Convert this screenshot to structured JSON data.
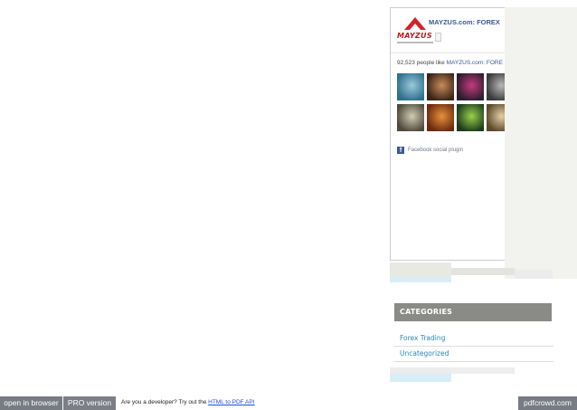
{
  "facebook_box": {
    "logo_word": "MAYZUS",
    "title": "MAYZUS.com: FOREX",
    "likes_count": "92,523",
    "likes_text": "people like",
    "likes_link": "MAYZUS.com: FORE",
    "plugin_label": "Facebook social plugin",
    "faces": [
      {
        "name": "face-1",
        "colors": [
          "#2e6f8e",
          "#9cc9da"
        ]
      },
      {
        "name": "face-2",
        "colors": [
          "#3a2418",
          "#c98b5a"
        ]
      },
      {
        "name": "face-3",
        "colors": [
          "#2b1d2e",
          "#c63a7e"
        ]
      },
      {
        "name": "face-4",
        "colors": [
          "#3a3a3a",
          "#b9b9b9"
        ]
      },
      {
        "name": "face-5",
        "colors": [
          "#4f4a3c",
          "#d2cbb4"
        ]
      },
      {
        "name": "face-6",
        "colors": [
          "#6b2a10",
          "#e8913a"
        ]
      },
      {
        "name": "face-7",
        "colors": [
          "#1d3b1d",
          "#9ad14a"
        ]
      },
      {
        "name": "face-8",
        "colors": [
          "#5a4a2a",
          "#e8cfa5"
        ]
      }
    ]
  },
  "categories": {
    "title": "CATEGORIES",
    "items": [
      {
        "label": "Forex Trading"
      },
      {
        "label": "Uncategorized"
      }
    ]
  },
  "footer": {
    "open_label": "open in browser",
    "pro_label": "PRO version",
    "promo_text": "Are you a developer? Try out the",
    "promo_link": "HTML to PDF API",
    "brand_label": "pdfcrowd.com"
  }
}
